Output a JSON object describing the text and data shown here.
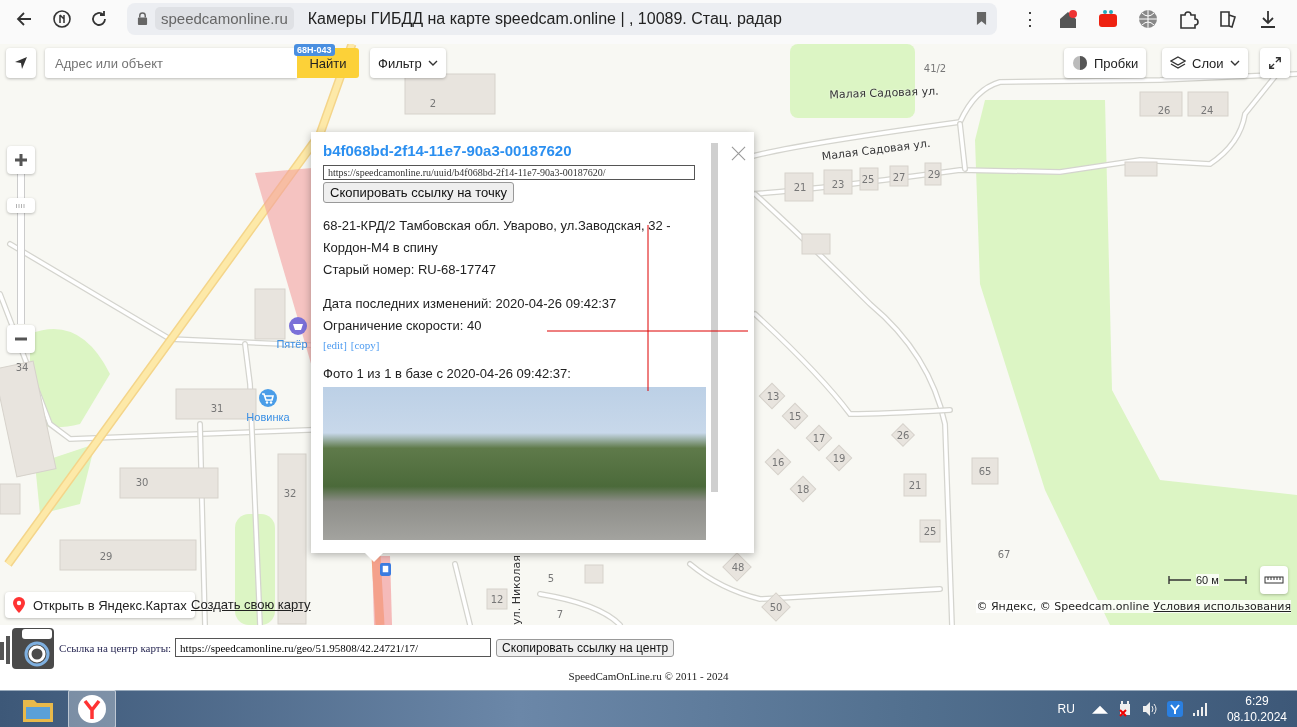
{
  "browser": {
    "domain": "speedcamonline.ru",
    "title": "Камеры ГИБДД на карте speedcam.online | , 10089. Стац. радар",
    "menu_glyph": "⋮"
  },
  "map": {
    "search": {
      "placeholder": "Адрес или объект"
    },
    "search_button": "Найти",
    "filter": "Фильтр",
    "traffic": "Пробки",
    "layers": "Слои",
    "road_badge": "68Н-043",
    "labels": [
      {
        "kind": "house",
        "text": "2"
      },
      {
        "kind": "house",
        "text": "41/2"
      },
      {
        "kind": "street",
        "text": "Малая Садовая ул."
      },
      {
        "kind": "street",
        "text": "Малая Садовая ул."
      },
      {
        "kind": "house",
        "text": "26"
      },
      {
        "kind": "house",
        "text": "24"
      },
      {
        "kind": "house",
        "text": "21"
      },
      {
        "kind": "house",
        "text": "23"
      },
      {
        "kind": "house",
        "text": "25"
      },
      {
        "kind": "house",
        "text": "27"
      },
      {
        "kind": "house",
        "text": "29"
      },
      {
        "kind": "house",
        "text": "34"
      },
      {
        "kind": "poi",
        "text": "Пятёр"
      },
      {
        "kind": "poi",
        "text": "Новинка"
      },
      {
        "kind": "house",
        "text": "31"
      },
      {
        "kind": "house",
        "text": "30"
      },
      {
        "kind": "house",
        "text": "32"
      },
      {
        "kind": "house",
        "text": "29"
      },
      {
        "kind": "house",
        "text": "13"
      },
      {
        "kind": "house",
        "text": "15"
      },
      {
        "kind": "house",
        "text": "17"
      },
      {
        "kind": "house",
        "text": "19"
      },
      {
        "kind": "house",
        "text": "26"
      },
      {
        "kind": "house",
        "text": "16"
      },
      {
        "kind": "house",
        "text": "18"
      },
      {
        "kind": "house",
        "text": "21"
      },
      {
        "kind": "house",
        "text": "65"
      },
      {
        "kind": "house",
        "text": "25"
      },
      {
        "kind": "house",
        "text": "67"
      },
      {
        "kind": "house",
        "text": "48"
      },
      {
        "kind": "house",
        "text": "50"
      },
      {
        "kind": "house",
        "text": "5"
      },
      {
        "kind": "house",
        "text": "12"
      },
      {
        "kind": "house",
        "text": "7"
      },
      {
        "kind": "street",
        "text": "ул. Николая"
      }
    ],
    "open_in_maps": "Открыть в Яндекс.Картах",
    "create_map": "Создать свою карту",
    "scale": "60 м",
    "copyright": "© Яндекс, © Speedcam.online",
    "terms": "Условия использования"
  },
  "popup": {
    "title": "b4f068bd-2f14-11e7-90a3-00187620",
    "url": "https://speedcamonline.ru/uuid/b4f068bd-2f14-11e7-90a3-00187620/",
    "copy_button": "Скопировать ссылку на точку",
    "address": "68-21-КРД/2 Тамбовская обл. Уварово, ул.Заводская, 32 - Кордон-М4 в спину",
    "old_number": "Старый номер: RU-68-17747",
    "changed": "Дата последних изменений: 2020-04-26 09:42:37",
    "speed_limit": "Ограничение скорости: 40",
    "links": [
      "[edit]",
      "[copy]"
    ],
    "photo_caption": "Фото 1 из 1 в базе с 2020-04-26 09:42:37:"
  },
  "center_link": {
    "label": "Ссылка на центр карты:",
    "value": "https://speedcamonline.ru/geo/51.95808/42.24721/17/",
    "button": "Скопировать ссылку на центр"
  },
  "footer": "SpeedCamOnLine.ru © 2011 - 2024",
  "taskbar": {
    "language": "RU",
    "time": "6:29",
    "date": "08.10.2024"
  }
}
